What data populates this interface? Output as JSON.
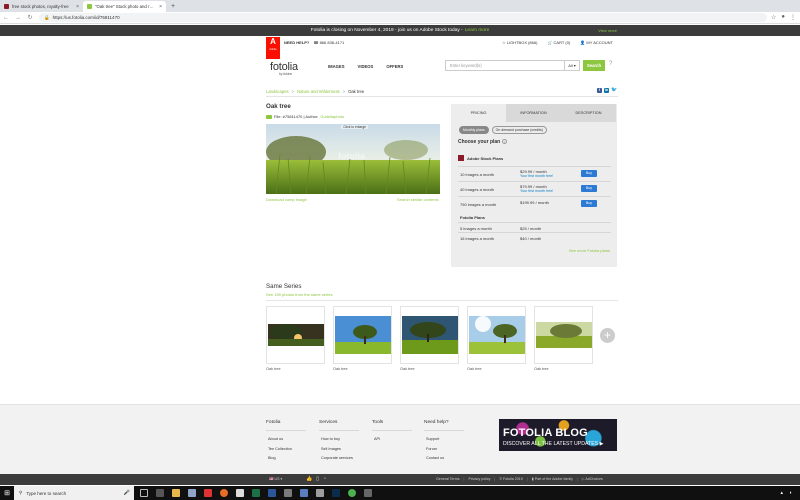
{
  "browser": {
    "tabs": [
      {
        "title": "free stock photos, royalty-free",
        "active": false,
        "favicon_color": "#8b1b2a"
      },
      {
        "title": "\"Oak tree\" Stock photo and royalt",
        "active": true,
        "favicon_color": "#8dc63f"
      }
    ],
    "new_tab": "+",
    "close_glyph": "×",
    "url": "https://us.fotolia.com/id/75811470"
  },
  "promo": {
    "text": "Fotolia is closing on November 4, 2019 - join us on Adobe Stock today -",
    "link": "Learn more",
    "view_more": "View more"
  },
  "header": {
    "logo_text": "A",
    "logo_sub": "Adobe",
    "help_label": "NEED HELP?",
    "phone": "866 836-4171",
    "lightbox": "LIGHTBOX (866)",
    "cart": "CART (0)",
    "account": "MY ACCOUNT",
    "brand": "fotolia",
    "brand_sub": "by Adobe",
    "nav": [
      "IMAGES",
      "VIDEOS",
      "OFFERS"
    ],
    "search_placeholder": "Enter keyword(s)",
    "search_filter": "All",
    "search_button": "Search",
    "help_icon": "?"
  },
  "breadcrumb": [
    "Landscapes",
    "Nature and Wilderness",
    "Oak tree"
  ],
  "photo": {
    "title": "Oak tree",
    "file_info": "File: #75811470 | Author:",
    "author": "Gudellaphoto",
    "enlarge": "Click to enlarge",
    "watermark": "fotolia",
    "download_comp": "Download comp image",
    "search_similar": "Search similar contents"
  },
  "pricing": {
    "tabs": [
      "PRICING",
      "INFORMATION",
      "DESCRIPTION"
    ],
    "toggle": [
      "Monthly plans",
      "On demand purchase (credits)"
    ],
    "choose": "Choose your plan",
    "adobe_plan_title": "Adobe Stock Plans",
    "adobe_rows": [
      {
        "label": "10 images a month",
        "price": "$29.99 / month",
        "free": "Your first month free!",
        "buy": "Buy"
      },
      {
        "label": "40 images a month",
        "price": "$79.99 / month",
        "free": "Your first month free!",
        "buy": "Buy"
      },
      {
        "label": "750 images a month",
        "price": "$199.99 / month",
        "free": "",
        "buy": "Buy"
      }
    ],
    "fotolia_title": "Fotolia Plans",
    "fotolia_rows": [
      {
        "label": "5 images a month",
        "price": "$25 / month"
      },
      {
        "label": "16 images a month",
        "price": "$40 / month"
      }
    ],
    "see_more": "See more Fotolia plans"
  },
  "series": {
    "title": "Same Series",
    "subtitle": "See 159 photos from the same series",
    "items": [
      "Oak tree",
      "Oak tree",
      "Oak tree",
      "Oak tree",
      "Oak tree"
    ],
    "more": "+"
  },
  "footer": {
    "columns": [
      {
        "heading": "Fotolia",
        "links": [
          "About us",
          "Ten Collection",
          "Blog"
        ]
      },
      {
        "heading": "Services",
        "links": [
          "How to buy",
          "Sell Images",
          "Corporate services"
        ]
      },
      {
        "heading": "Tools",
        "links": [
          "API"
        ]
      },
      {
        "heading": "Need help?",
        "links": [
          "Support",
          "Forum",
          "Contact us"
        ]
      }
    ],
    "blog_title": "FOTOLIA BLOG",
    "blog_sub": "DISCOVER ALL THE LATEST UPDATES ▶"
  },
  "bottombar": {
    "language": "US",
    "links": [
      "General Terms",
      "Privacy policy",
      "© Fotolia 2019",
      "Part of the Adobe family",
      "AdChoices"
    ]
  },
  "taskbar": {
    "search_placeholder": "Type here to search"
  }
}
